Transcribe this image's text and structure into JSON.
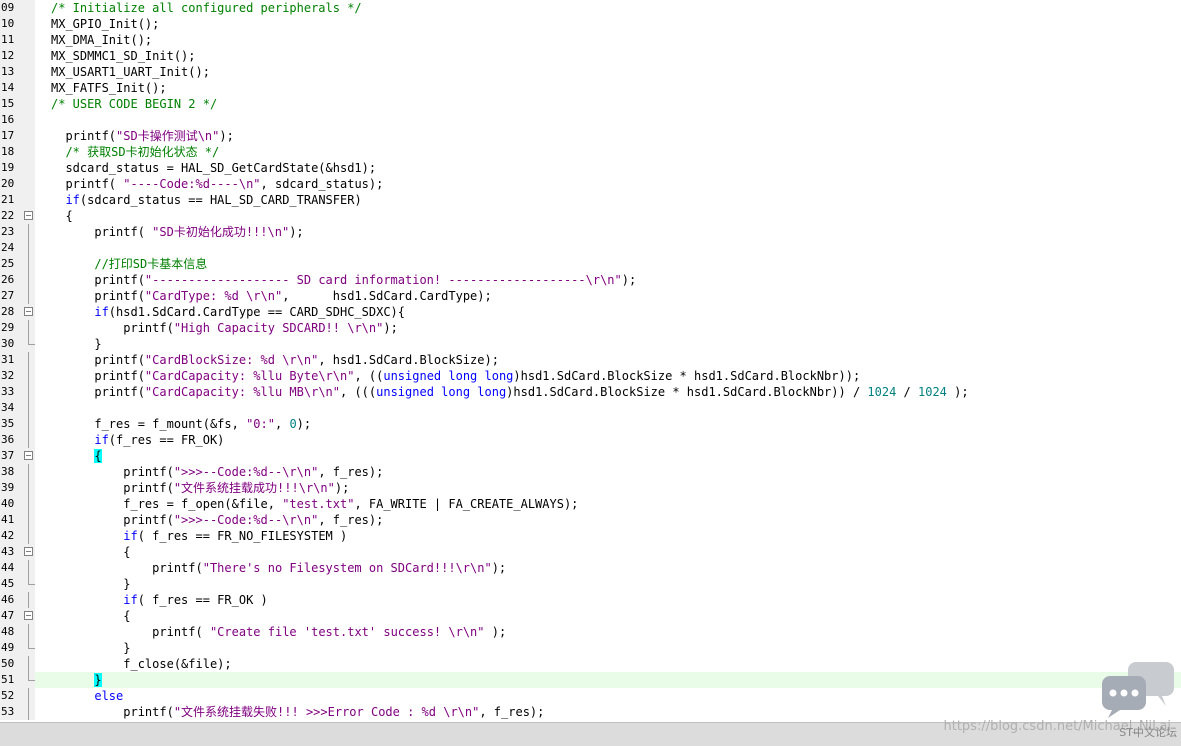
{
  "editor": {
    "lines": [
      {
        "num": "09",
        "fold": "none",
        "hl": false,
        "tokens": [
          {
            "t": "cmt",
            "v": "/* Initialize all configured peripherals */"
          }
        ]
      },
      {
        "num": "10",
        "fold": "none",
        "hl": false,
        "tokens": [
          {
            "t": "plain",
            "v": "MX_GPIO_Init();"
          }
        ]
      },
      {
        "num": "11",
        "fold": "none",
        "hl": false,
        "tokens": [
          {
            "t": "plain",
            "v": "MX_DMA_Init();"
          }
        ]
      },
      {
        "num": "12",
        "fold": "none",
        "hl": false,
        "tokens": [
          {
            "t": "plain",
            "v": "MX_SDMMC1_SD_Init();"
          }
        ]
      },
      {
        "num": "13",
        "fold": "none",
        "hl": false,
        "tokens": [
          {
            "t": "plain",
            "v": "MX_USART1_UART_Init();"
          }
        ]
      },
      {
        "num": "14",
        "fold": "none",
        "hl": false,
        "tokens": [
          {
            "t": "plain",
            "v": "MX_FATFS_Init();"
          }
        ]
      },
      {
        "num": "15",
        "fold": "none",
        "hl": false,
        "tokens": [
          {
            "t": "cmt",
            "v": "/* USER CODE BEGIN 2 */"
          }
        ]
      },
      {
        "num": "16",
        "fold": "none",
        "hl": false,
        "tokens": []
      },
      {
        "num": "17",
        "fold": "none",
        "hl": false,
        "tokens": [
          {
            "t": "plain",
            "v": "  printf("
          },
          {
            "t": "str",
            "v": "\"SD卡操作测试\\n\""
          },
          {
            "t": "plain",
            "v": ");"
          }
        ]
      },
      {
        "num": "18",
        "fold": "none",
        "hl": false,
        "tokens": [
          {
            "t": "cmt",
            "v": "  /* 获取SD卡初始化状态 */"
          }
        ]
      },
      {
        "num": "19",
        "fold": "none",
        "hl": false,
        "tokens": [
          {
            "t": "plain",
            "v": "  sdcard_status = HAL_SD_GetCardState(&hsd1);"
          }
        ]
      },
      {
        "num": "20",
        "fold": "none",
        "hl": false,
        "tokens": [
          {
            "t": "plain",
            "v": "  printf( "
          },
          {
            "t": "str",
            "v": "\"----Code:%d----\\n\""
          },
          {
            "t": "plain",
            "v": ", sdcard_status);"
          }
        ]
      },
      {
        "num": "21",
        "fold": "none",
        "hl": false,
        "tokens": [
          {
            "t": "kw",
            "v": "  if"
          },
          {
            "t": "plain",
            "v": "(sdcard_status == HAL_SD_CARD_TRANSFER)"
          }
        ]
      },
      {
        "num": "22",
        "fold": "open",
        "hl": false,
        "tokens": [
          {
            "t": "plain",
            "v": "  {"
          }
        ]
      },
      {
        "num": "23",
        "fold": "line",
        "hl": false,
        "tokens": [
          {
            "t": "plain",
            "v": "      printf( "
          },
          {
            "t": "str",
            "v": "\"SD卡初始化成功!!!\\n\""
          },
          {
            "t": "plain",
            "v": ");"
          }
        ]
      },
      {
        "num": "24",
        "fold": "line",
        "hl": false,
        "tokens": []
      },
      {
        "num": "25",
        "fold": "line",
        "hl": false,
        "tokens": [
          {
            "t": "cmt",
            "v": "      //打印SD卡基本信息"
          }
        ]
      },
      {
        "num": "26",
        "fold": "line",
        "hl": false,
        "tokens": [
          {
            "t": "plain",
            "v": "      printf("
          },
          {
            "t": "str",
            "v": "\"------------------- SD card information! -------------------\\r\\n\""
          },
          {
            "t": "plain",
            "v": ");"
          }
        ]
      },
      {
        "num": "27",
        "fold": "line",
        "hl": false,
        "tokens": [
          {
            "t": "plain",
            "v": "      printf("
          },
          {
            "t": "str",
            "v": "\"CardType: %d \\r\\n\""
          },
          {
            "t": "plain",
            "v": ",      hsd1.SdCard.CardType);"
          }
        ]
      },
      {
        "num": "28",
        "fold": "open",
        "hl": false,
        "tokens": [
          {
            "t": "kw",
            "v": "      if"
          },
          {
            "t": "plain",
            "v": "(hsd1.SdCard.CardType == CARD_SDHC_SDXC){"
          }
        ]
      },
      {
        "num": "29",
        "fold": "line",
        "hl": false,
        "tokens": [
          {
            "t": "plain",
            "v": "          printf("
          },
          {
            "t": "str",
            "v": "\"High Capacity SDCARD!! \\r\\n\""
          },
          {
            "t": "plain",
            "v": ");"
          }
        ]
      },
      {
        "num": "30",
        "fold": "end",
        "hl": false,
        "tokens": [
          {
            "t": "plain",
            "v": "      }"
          }
        ]
      },
      {
        "num": "31",
        "fold": "line",
        "hl": false,
        "tokens": [
          {
            "t": "plain",
            "v": "      printf("
          },
          {
            "t": "str",
            "v": "\"CardBlockSize: %d \\r\\n\""
          },
          {
            "t": "plain",
            "v": ", hsd1.SdCard.BlockSize);"
          }
        ]
      },
      {
        "num": "32",
        "fold": "line",
        "hl": false,
        "tokens": [
          {
            "t": "plain",
            "v": "      printf("
          },
          {
            "t": "str",
            "v": "\"CardCapacity: %llu Byte\\r\\n\""
          },
          {
            "t": "plain",
            "v": ", (("
          },
          {
            "t": "kw",
            "v": "unsigned long long"
          },
          {
            "t": "plain",
            "v": ")hsd1.SdCard.BlockSize * hsd1.SdCard.BlockNbr));"
          }
        ]
      },
      {
        "num": "33",
        "fold": "line",
        "hl": false,
        "tokens": [
          {
            "t": "plain",
            "v": "      printf("
          },
          {
            "t": "str",
            "v": "\"CardCapacity: %llu MB\\r\\n\""
          },
          {
            "t": "plain",
            "v": ", ((("
          },
          {
            "t": "kw",
            "v": "unsigned long long"
          },
          {
            "t": "plain",
            "v": ")hsd1.SdCard.BlockSize * hsd1.SdCard.BlockNbr)) / "
          },
          {
            "t": "num",
            "v": "1024"
          },
          {
            "t": "plain",
            "v": " / "
          },
          {
            "t": "num",
            "v": "1024"
          },
          {
            "t": "plain",
            "v": " );"
          }
        ]
      },
      {
        "num": "34",
        "fold": "line",
        "hl": false,
        "tokens": []
      },
      {
        "num": "35",
        "fold": "line",
        "hl": false,
        "tokens": [
          {
            "t": "plain",
            "v": "      f_res = f_mount(&fs, "
          },
          {
            "t": "str",
            "v": "\"0:\""
          },
          {
            "t": "plain",
            "v": ", "
          },
          {
            "t": "num",
            "v": "0"
          },
          {
            "t": "plain",
            "v": ");"
          }
        ]
      },
      {
        "num": "36",
        "fold": "line",
        "hl": false,
        "tokens": [
          {
            "t": "kw",
            "v": "      if"
          },
          {
            "t": "plain",
            "v": "(f_res == FR_OK)"
          }
        ]
      },
      {
        "num": "37",
        "fold": "open",
        "hl": false,
        "tokens": [
          {
            "t": "plain",
            "v": "      "
          },
          {
            "t": "brace",
            "v": "{"
          }
        ]
      },
      {
        "num": "38",
        "fold": "line",
        "hl": false,
        "tokens": [
          {
            "t": "plain",
            "v": "          printf("
          },
          {
            "t": "str",
            "v": "\">>>--Code:%d--\\r\\n\""
          },
          {
            "t": "plain",
            "v": ", f_res);"
          }
        ]
      },
      {
        "num": "39",
        "fold": "line",
        "hl": false,
        "tokens": [
          {
            "t": "plain",
            "v": "          printf("
          },
          {
            "t": "str",
            "v": "\"文件系统挂载成功!!!\\r\\n\""
          },
          {
            "t": "plain",
            "v": ");"
          }
        ]
      },
      {
        "num": "40",
        "fold": "line",
        "hl": false,
        "tokens": [
          {
            "t": "plain",
            "v": "          f_res = f_open(&file, "
          },
          {
            "t": "str",
            "v": "\"test.txt\""
          },
          {
            "t": "plain",
            "v": ", FA_WRITE | FA_CREATE_ALWAYS);"
          }
        ]
      },
      {
        "num": "41",
        "fold": "line",
        "hl": false,
        "tokens": [
          {
            "t": "plain",
            "v": "          printf("
          },
          {
            "t": "str",
            "v": "\">>>--Code:%d--\\r\\n\""
          },
          {
            "t": "plain",
            "v": ", f_res);"
          }
        ]
      },
      {
        "num": "42",
        "fold": "line",
        "hl": false,
        "tokens": [
          {
            "t": "kw",
            "v": "          if"
          },
          {
            "t": "plain",
            "v": "( f_res == FR_NO_FILESYSTEM )"
          }
        ]
      },
      {
        "num": "43",
        "fold": "open",
        "hl": false,
        "tokens": [
          {
            "t": "plain",
            "v": "          {"
          }
        ]
      },
      {
        "num": "44",
        "fold": "line",
        "hl": false,
        "tokens": [
          {
            "t": "plain",
            "v": "              printf("
          },
          {
            "t": "str",
            "v": "\"There's no Filesystem on SDCard!!!\\r\\n\""
          },
          {
            "t": "plain",
            "v": ");"
          }
        ]
      },
      {
        "num": "45",
        "fold": "end",
        "hl": false,
        "tokens": [
          {
            "t": "plain",
            "v": "          }"
          }
        ]
      },
      {
        "num": "46",
        "fold": "line",
        "hl": false,
        "tokens": [
          {
            "t": "kw",
            "v": "          if"
          },
          {
            "t": "plain",
            "v": "( f_res == FR_OK )"
          }
        ]
      },
      {
        "num": "47",
        "fold": "open",
        "hl": false,
        "tokens": [
          {
            "t": "plain",
            "v": "          {"
          }
        ]
      },
      {
        "num": "48",
        "fold": "line",
        "hl": false,
        "tokens": [
          {
            "t": "plain",
            "v": "              printf( "
          },
          {
            "t": "str",
            "v": "\"Create file 'test.txt' success! \\r\\n\""
          },
          {
            "t": "plain",
            "v": " );"
          }
        ]
      },
      {
        "num": "49",
        "fold": "end",
        "hl": false,
        "tokens": [
          {
            "t": "plain",
            "v": "          }"
          }
        ]
      },
      {
        "num": "50",
        "fold": "line",
        "hl": false,
        "tokens": [
          {
            "t": "plain",
            "v": "          f_close(&file);"
          }
        ]
      },
      {
        "num": "51",
        "fold": "end",
        "hl": true,
        "tokens": [
          {
            "t": "plain",
            "v": "      "
          },
          {
            "t": "brace",
            "v": "}"
          }
        ]
      },
      {
        "num": "52",
        "fold": "line",
        "hl": false,
        "tokens": [
          {
            "t": "kw",
            "v": "      else"
          }
        ]
      },
      {
        "num": "53",
        "fold": "line",
        "hl": false,
        "tokens": [
          {
            "t": "plain",
            "v": "          printf("
          },
          {
            "t": "str",
            "v": "\"文件系统挂载失败!!! >>>Error Code : %d \\r\\n\""
          },
          {
            "t": "plain",
            "v": ", f_res);"
          }
        ]
      }
    ]
  },
  "watermark": {
    "text": "https://blog.csdn.net/Michael_NiLai",
    "badge": "ST中文论坛"
  },
  "colors": {
    "keyword": "#0000ff",
    "string": "#800080",
    "comment": "#008000",
    "number": "#008080",
    "brace_match": "#00ffff",
    "current_line": "#e8fce8"
  }
}
